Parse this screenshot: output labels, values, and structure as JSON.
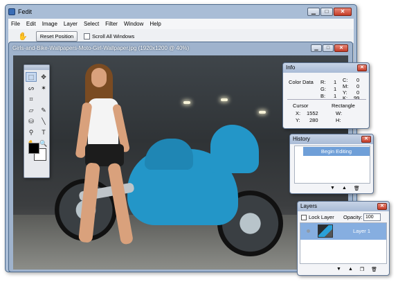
{
  "app": {
    "title": "Fedit",
    "window_buttons": {
      "minimize": "▁",
      "maximize": "□",
      "close": "✕"
    }
  },
  "menu": [
    "File",
    "Edit",
    "Image",
    "Layer",
    "Select",
    "Filter",
    "Window",
    "Help"
  ],
  "options_bar": {
    "hand_icon": "hand-icon",
    "reset_label": "Reset Position",
    "scroll_all_label": "Scroll All Windows",
    "scroll_all_checked": false
  },
  "document": {
    "title": "Girls-and-Bike-Wallpapers-Moto-Girl-Wallpaper.jpg (1920x1200 @ 40%)"
  },
  "toolbox": {
    "tools": [
      "marquee-icon",
      "move-icon",
      "lasso-icon",
      "magic-wand-icon",
      "crop-icon",
      "blank",
      "eraser-icon",
      "brush-icon",
      "bucket-icon",
      "line-icon",
      "eyedropper-icon",
      "text-icon",
      "hand-icon",
      "zoom-icon"
    ],
    "glyphs": [
      "⬚",
      "✥",
      "ᔕ",
      "✶",
      "⌗",
      "",
      "▱",
      "✎",
      "⛁",
      "╲",
      "⚲",
      "T",
      "✋",
      "🔍"
    ]
  },
  "info": {
    "title": "Info",
    "color_data_label": "Color Data",
    "r_label": "R:",
    "r_value": "1",
    "g_label": "G:",
    "g_value": "1",
    "b_label": "B:",
    "b_value": "1",
    "c_label": "C:",
    "c_value": "0",
    "m_label": "M:",
    "m_value": "0",
    "y_label": "Y:",
    "y_value": "0",
    "k_label": "K:",
    "k_value": "99",
    "cursor_label": "Cursor",
    "rectangle_label": "Rectangle",
    "x_label": "X:",
    "x_value": "1552",
    "cy_label": "Y:",
    "cy_value": "280",
    "w_label": "W:",
    "h_label": "H:"
  },
  "history": {
    "title": "History",
    "items": [
      "Begin Editing"
    ],
    "footer_icons": [
      "▼",
      "▲",
      "🗑"
    ]
  },
  "layers": {
    "title": "Layers",
    "lock_label": "Lock Layer",
    "opacity_label": "Opacity:",
    "opacity_value": "100",
    "items": [
      "Layer 1"
    ],
    "footer_icons": [
      "▼",
      "▲",
      "❐",
      "🗑"
    ]
  }
}
